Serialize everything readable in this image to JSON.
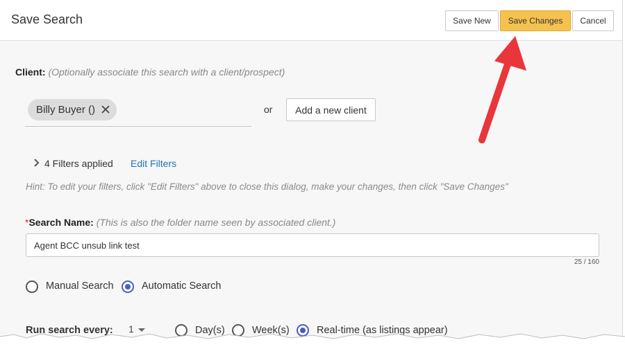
{
  "dialog": {
    "title": "Save Search",
    "buttons": {
      "save_new": "Save New",
      "save_changes": "Save Changes",
      "cancel": "Cancel"
    }
  },
  "client": {
    "label": "Client:",
    "hint": "(Optionally associate this search with a client/prospect)",
    "chip": "Billy Buyer ()",
    "or_text": "or",
    "add_button": "Add a new client"
  },
  "filters": {
    "summary": "4 Filters applied",
    "edit_link": "Edit Filters",
    "hint": "Hint: To edit your filters, click \"Edit Filters\" above to close this dialog, make your changes, then click \"Save Changes\""
  },
  "search_name": {
    "required_mark": "*",
    "label": "Search Name:",
    "hint": "(This is also the folder name seen by associated client.)",
    "value": "Agent BCC unsub link test",
    "counter": "25 / 160"
  },
  "search_type": {
    "options": [
      {
        "label": "Manual Search",
        "selected": false
      },
      {
        "label": "Automatic Search",
        "selected": true
      }
    ]
  },
  "run_search": {
    "label": "Run search every:",
    "interval_value": "1",
    "options": [
      {
        "label": "Day(s)",
        "selected": false
      },
      {
        "label": "Week(s)",
        "selected": false
      },
      {
        "label": "Real-time (as listings appear)",
        "selected": true
      }
    ]
  },
  "colors": {
    "accent": "#f6c24f",
    "link": "#1a73b8",
    "radio": "#4a5bc4",
    "annotation_arrow": "#e8363b"
  },
  "icons": {
    "chip_remove": "close-icon",
    "filters_toggle": "chevron-right-icon",
    "dropdown": "caret-down-icon",
    "annotation": "red-arrow-icon"
  }
}
